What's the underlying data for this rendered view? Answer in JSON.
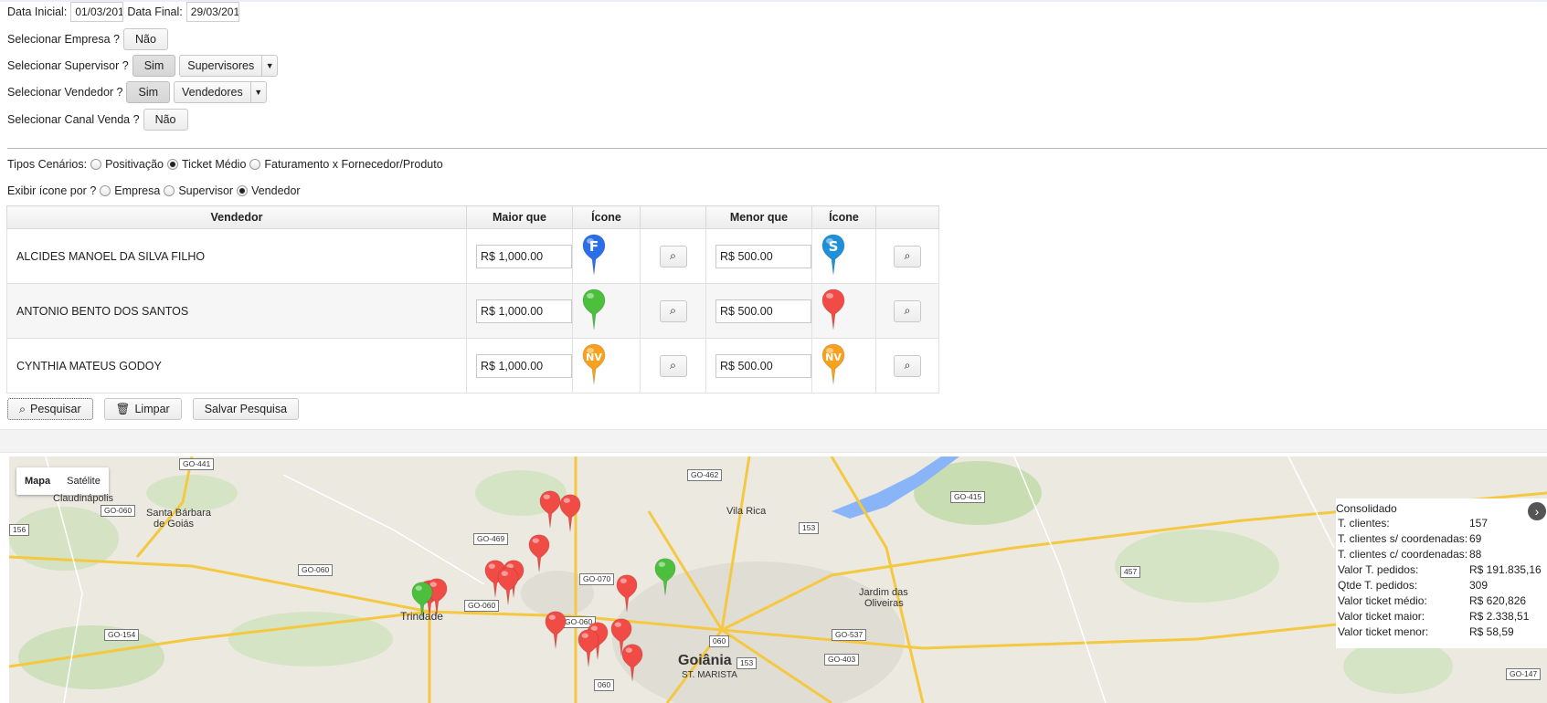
{
  "filters": {
    "data_inicial_label": "Data Inicial:",
    "data_inicial_value": "01/03/201",
    "data_final_label": "Data Final:",
    "data_final_value": "29/03/201",
    "empresa_label": "Selecionar Empresa ?",
    "empresa_btn": "Não",
    "supervisor_label": "Selecionar Supervisor ?",
    "supervisor_btn": "Sim",
    "supervisor_select": "Supervisores",
    "vendedor_label": "Selecionar Vendedor ?",
    "vendedor_btn": "Sim",
    "vendedor_select": "Vendedores",
    "canal_label": "Selecionar Canal Venda ?",
    "canal_btn": "Não"
  },
  "cenarios": {
    "label": "Tipos Cenários:",
    "options": [
      "Positivação",
      "Ticket Médio",
      "Faturamento x Fornecedor/Produto"
    ],
    "selected": "Ticket Médio"
  },
  "icone_por": {
    "label": "Exibir ícone por ?",
    "options": [
      "Empresa",
      "Supervisor",
      "Vendedor"
    ],
    "selected": "Vendedor"
  },
  "table": {
    "headers": [
      "Vendedor",
      "Maior que",
      "Ícone",
      "",
      "Menor que",
      "Ícone",
      ""
    ],
    "rows": [
      {
        "vendedor": "ALCIDES MANOEL DA SILVA FILHO",
        "maior": "R$ 1,000.00",
        "icon1": "F",
        "color1": "#2a6ee8",
        "menor": "R$ 500.00",
        "icon2": "S",
        "color2": "#1f8fd8"
      },
      {
        "vendedor": "ANTONIO BENTO DOS SANTOS",
        "maior": "R$ 1,000.00",
        "icon1": "",
        "color1": "#4cbf3d",
        "menor": "R$ 500.00",
        "icon2": "",
        "color2": "#f04b45"
      },
      {
        "vendedor": "CYNTHIA MATEUS GODOY",
        "maior": "R$ 1,000.00",
        "icon1": "NV",
        "color1": "#f7a11e",
        "menor": "R$ 500.00",
        "icon2": "NV",
        "color2": "#f7a11e"
      }
    ]
  },
  "actions": {
    "pesquisar": "Pesquisar",
    "limpar": "Limpar",
    "salvar": "Salvar Pesquisa"
  },
  "map": {
    "type_map": "Mapa",
    "type_sat": "Satélite",
    "places": [
      "Claudinápolis",
      "Santa Bárbara",
      "de Goiás",
      "Trindade",
      "Vila Rica",
      "Jardim das",
      "Oliveiras",
      "Goiânia",
      "ST. MARISTA"
    ],
    "roads": [
      "GO-441",
      "GO-060",
      "GO-060",
      "GO-469",
      "GO-060",
      "GO-154",
      "GO-070",
      "GO-060",
      "GO-462",
      "153",
      "GO-415",
      "457",
      "GO-537",
      "GO-403",
      "060",
      "153",
      "156",
      "060",
      "GO-147"
    ]
  },
  "consolidado": {
    "title": "Consolidado",
    "rows": [
      {
        "label": "T. clientes:",
        "value": "157"
      },
      {
        "label": "T. clientes s/ coordenadas:",
        "value": "69"
      },
      {
        "label": "T. clientes c/ coordenadas:",
        "value": "88"
      },
      {
        "label": "Valor T. pedidos:",
        "value": "R$ 191.835,16"
      },
      {
        "label": "Qtde T. pedidos:",
        "value": "309"
      },
      {
        "label": "Valor ticket médio:",
        "value": "R$ 620,826"
      },
      {
        "label": "Valor ticket maior:",
        "value": "R$ 2.338,51"
      },
      {
        "label": "Valor ticket menor:",
        "value": "R$ 58,59"
      }
    ]
  },
  "icon_names": [
    "search-icon",
    "trash-icon",
    "chevron-right-icon",
    "map-pin-icon"
  ]
}
